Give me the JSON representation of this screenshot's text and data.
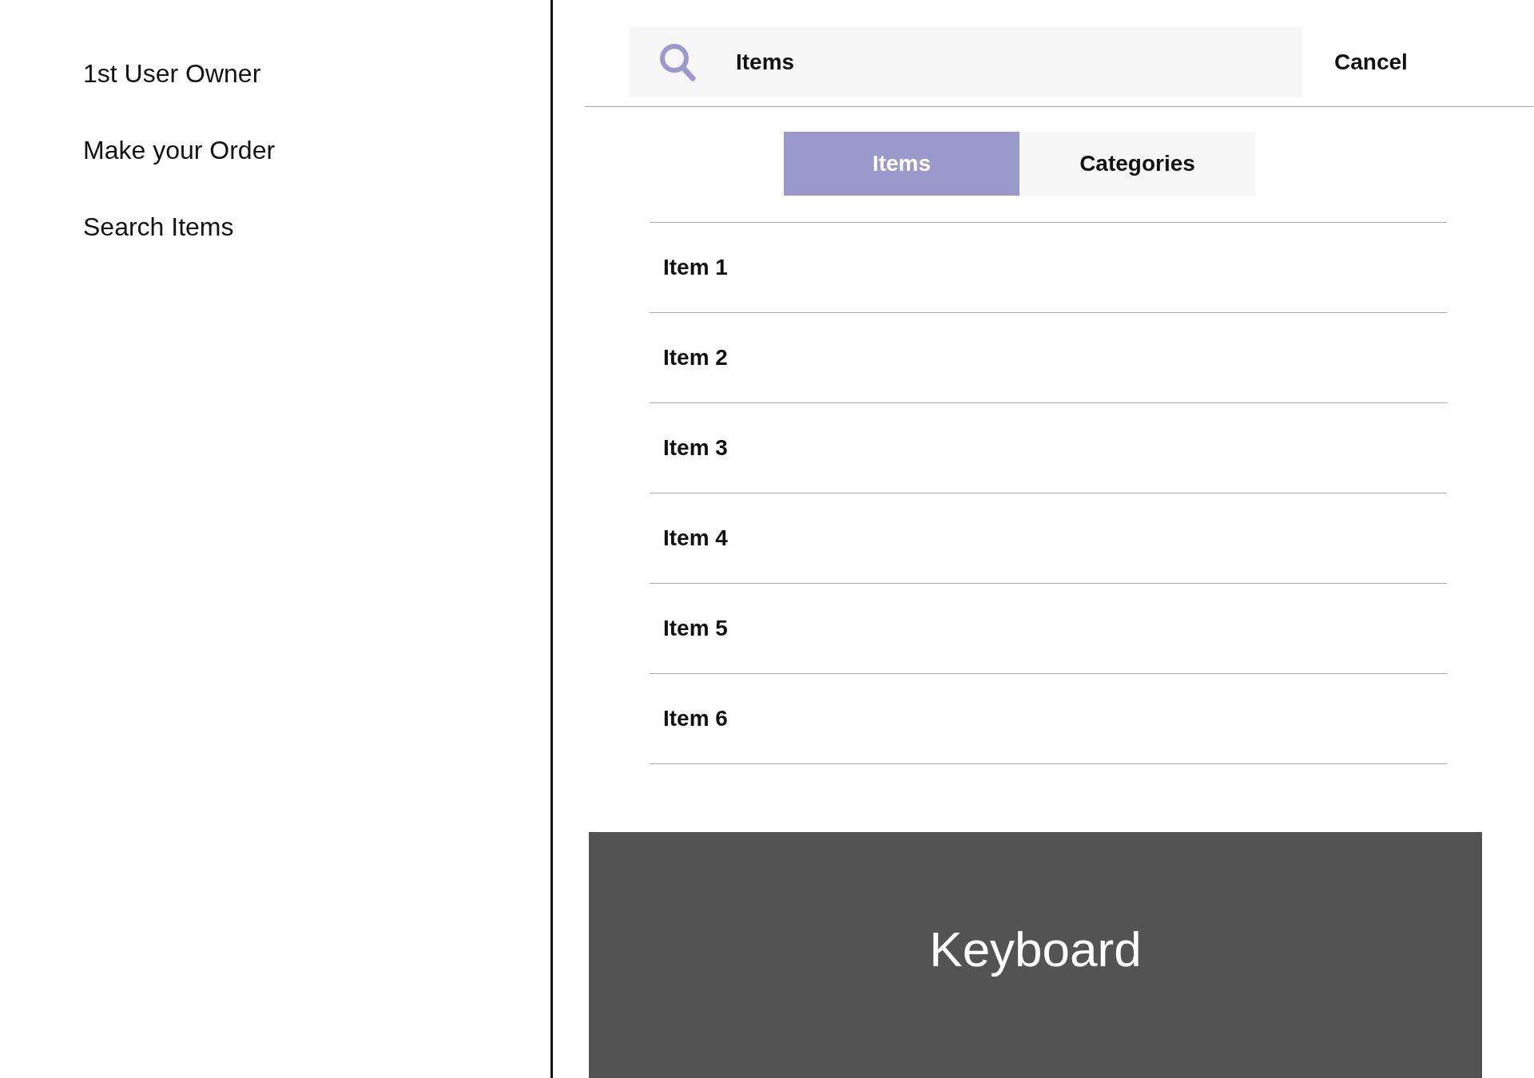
{
  "sidebar": {
    "items": [
      {
        "label": "1st User Owner"
      },
      {
        "label": "Make your Order"
      },
      {
        "label": "Search Items"
      }
    ]
  },
  "search": {
    "value": "Items"
  },
  "cancel": "Cancel",
  "tabs": [
    {
      "label": "Items",
      "selected": true
    },
    {
      "label": "Categories",
      "selected": false
    }
  ],
  "items": [
    {
      "label": "Item 1"
    },
    {
      "label": "Item 2"
    },
    {
      "label": "Item 3"
    },
    {
      "label": "Item 4"
    },
    {
      "label": "Item 5"
    },
    {
      "label": "Item 6"
    }
  ],
  "keyboard": {
    "label": "Keyboard"
  }
}
